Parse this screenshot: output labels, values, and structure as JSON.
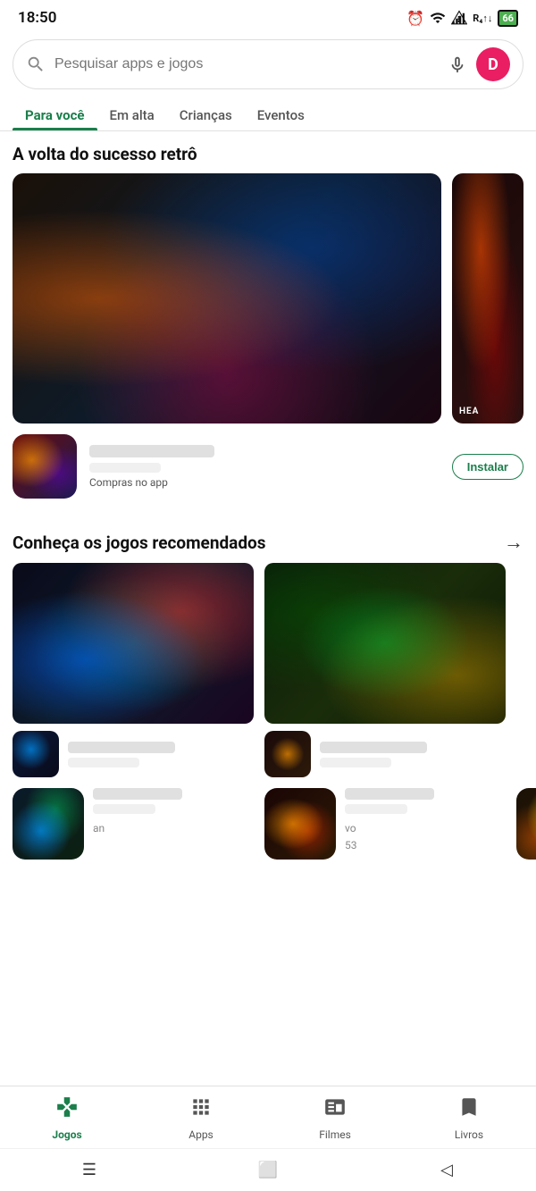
{
  "statusBar": {
    "time": "18:50",
    "alarm_icon": "⏰",
    "wifi_icon": "wifi",
    "signal1_icon": "signal",
    "signal2_icon": "signal",
    "battery": "66"
  },
  "searchBar": {
    "placeholder": "Pesquisar apps e jogos",
    "avatar_initial": "D"
  },
  "tabs": [
    {
      "id": "para-voce",
      "label": "Para você",
      "active": true
    },
    {
      "id": "em-alta",
      "label": "Em alta",
      "active": false
    },
    {
      "id": "criancas",
      "label": "Crianças",
      "active": false
    },
    {
      "id": "eventos",
      "label": "Eventos",
      "active": false
    }
  ],
  "sections": {
    "retro": {
      "title": "A volta do sucesso retrô",
      "inAppPurchase": "Compras no app"
    },
    "recommended": {
      "title": "Conheça os jogos recomendados",
      "arrow": "→",
      "game1_count": "an",
      "game2_count": "vo",
      "game3_count": "53"
    }
  },
  "bottomNav": {
    "items": [
      {
        "id": "jogos",
        "label": "Jogos",
        "active": true,
        "icon": "🎮"
      },
      {
        "id": "apps",
        "label": "Apps",
        "active": false,
        "icon": "⊞"
      },
      {
        "id": "filmes",
        "label": "Filmes",
        "active": false,
        "icon": "🎬"
      },
      {
        "id": "livros",
        "label": "Livros",
        "active": false,
        "icon": "📖"
      }
    ]
  },
  "androidNav": {
    "menu": "☰",
    "home": "⬜",
    "back": "◁"
  }
}
